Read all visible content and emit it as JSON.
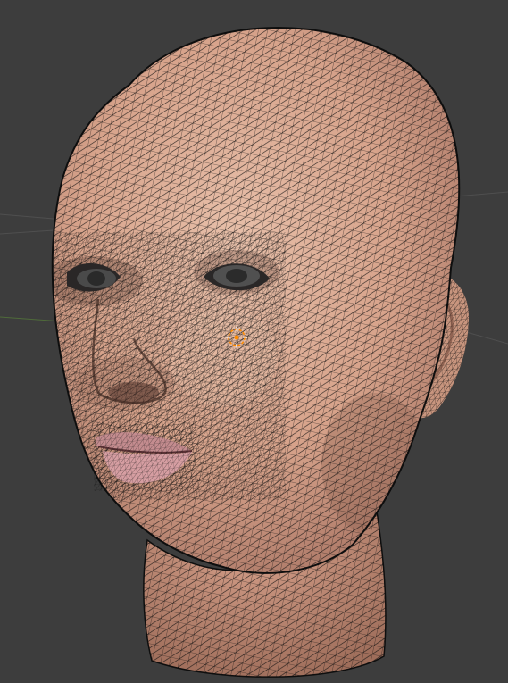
{
  "viewport": {
    "background_color": "#3d3d3d",
    "grid_line_color": "#4f4f4f",
    "x_axis_color": "#7b4b4b",
    "y_axis_color": "#4f6b3a"
  },
  "model": {
    "skin_base_color": "#d8a68d",
    "skin_shadow_color": "#a06f5a",
    "lip_color": "#c98f95",
    "wire_color": "#101010",
    "selected_edge_color": "#ffb400",
    "origin_marker_color": "#ff8c00"
  },
  "icons": {
    "origin": "origin-marker-icon"
  }
}
